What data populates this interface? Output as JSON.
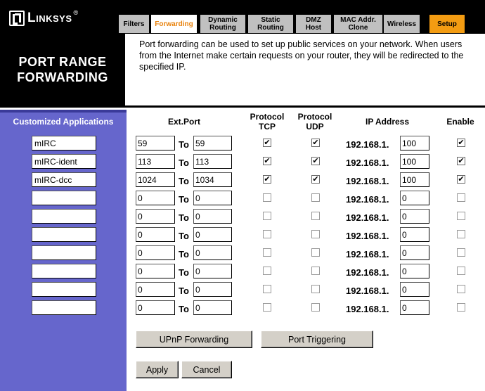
{
  "brand": {
    "logo_text": "Linksys",
    "logo_reg": "®"
  },
  "tabs": [
    {
      "label": "Filters",
      "active": false
    },
    {
      "label": "Forwarding",
      "active": true
    },
    {
      "label": "Dynamic\nRouting",
      "active": false
    },
    {
      "label": "Static\nRouting",
      "active": false
    },
    {
      "label": "DMZ\nHost",
      "active": false
    },
    {
      "label": "MAC Addr.\nClone",
      "active": false
    },
    {
      "label": "Wireless",
      "active": false
    },
    {
      "label": "Setup",
      "active": false
    }
  ],
  "page_title": {
    "line1": "PORT RANGE",
    "line2": "FORWARDING"
  },
  "description": "Port forwarding can be used to set up public services on your network. When users from the Internet make certain requests on your router, they will be redirected to the specified IP.",
  "columns": {
    "apps": "Customized Applications",
    "ext_port": "Ext.Port",
    "tcp": "Protocol\nTCP",
    "udp": "Protocol\nUDP",
    "ip": "IP Address",
    "enable": "Enable"
  },
  "to_label": "To",
  "ip_prefix": "192.168.1.",
  "rows": [
    {
      "app": "mIRC",
      "start": "59",
      "end": "59",
      "tcp": true,
      "udp": true,
      "ip": "100",
      "enable": true
    },
    {
      "app": "mIRC-ident",
      "start": "113",
      "end": "113",
      "tcp": true,
      "udp": true,
      "ip": "100",
      "enable": true
    },
    {
      "app": "mIRC-dcc",
      "start": "1024",
      "end": "1034",
      "tcp": true,
      "udp": true,
      "ip": "100",
      "enable": true
    },
    {
      "app": "",
      "start": "0",
      "end": "0",
      "tcp": false,
      "udp": false,
      "ip": "0",
      "enable": false
    },
    {
      "app": "",
      "start": "0",
      "end": "0",
      "tcp": false,
      "udp": false,
      "ip": "0",
      "enable": false
    },
    {
      "app": "",
      "start": "0",
      "end": "0",
      "tcp": false,
      "udp": false,
      "ip": "0",
      "enable": false
    },
    {
      "app": "",
      "start": "0",
      "end": "0",
      "tcp": false,
      "udp": false,
      "ip": "0",
      "enable": false
    },
    {
      "app": "",
      "start": "0",
      "end": "0",
      "tcp": false,
      "udp": false,
      "ip": "0",
      "enable": false
    },
    {
      "app": "",
      "start": "0",
      "end": "0",
      "tcp": false,
      "udp": false,
      "ip": "0",
      "enable": false
    },
    {
      "app": "",
      "start": "0",
      "end": "0",
      "tcp": false,
      "udp": false,
      "ip": "0",
      "enable": false
    }
  ],
  "buttons": {
    "upnp": "UPnP Forwarding",
    "triggering": "Port Triggering",
    "apply": "Apply",
    "cancel": "Cancel"
  },
  "colors": {
    "sidebar": "#6666cc",
    "active_tab_text": "#e8820c",
    "setup_tab": "#f39c12"
  }
}
